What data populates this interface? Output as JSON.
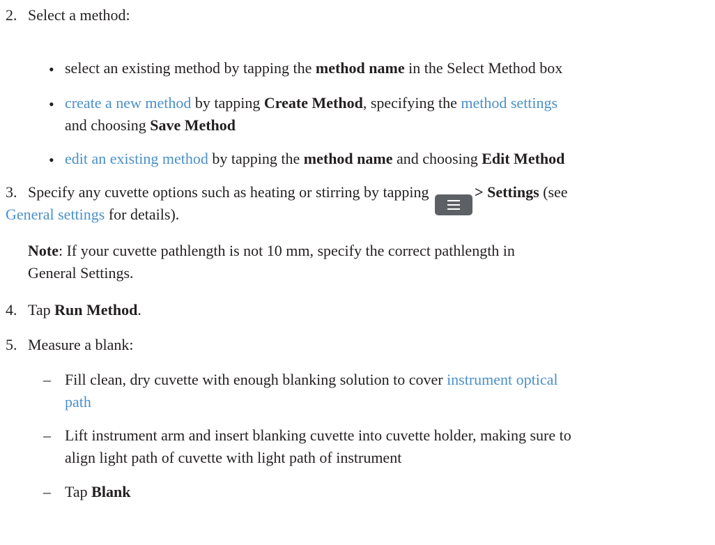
{
  "step2": {
    "num": "2.",
    "text": "Select a method:",
    "b1": {
      "pre": "select an existing method by tapping the ",
      "bold1": "method name",
      "post": " in the Select Method box"
    },
    "b2": {
      "link1": "create a new method",
      "mid1": " by tapping ",
      "bold1": "Create Method",
      "mid2": ", specifying the ",
      "link2": "method settings",
      "line2_pre": "and choosing ",
      "bold2": "Save Method"
    },
    "b3": {
      "link1": "edit an existing method",
      "mid1": " by tapping the ",
      "bold1": "method name",
      "mid2": " and choosing ",
      "bold2": "Edit Method"
    }
  },
  "step3": {
    "num": "3.",
    "pre": "Specify any cuvette options such as heating or stirring by tapping ",
    "menu_icon": "menu-icon",
    "bold1": "> Settings",
    "post": " (see",
    "link1": "General settings",
    "post2": " for details).",
    "note_label": "Note",
    "note_text1": ": If your cuvette pathlength is not 10 mm, specify the correct pathlength in",
    "note_text2": "General Settings."
  },
  "step4": {
    "num": "4.",
    "pre": "Tap ",
    "bold1": "Run Method",
    "post": "."
  },
  "step5": {
    "num": "5.",
    "text": "Measure a blank:",
    "d1": {
      "dash": "–",
      "pre": "Fill clean, dry cuvette with enough blanking solution to cover ",
      "link1": "instrument optical",
      "link1b": "path"
    },
    "d2": {
      "dash": "–",
      "line1": "Lift instrument arm and insert blanking cuvette into cuvette holder, making sure to",
      "line2": "align light path of cuvette with light path of instrument"
    },
    "d3": {
      "dash": "–",
      "pre": "Tap ",
      "bold1": "Blank"
    }
  },
  "colors": {
    "link": "#4a90c8",
    "text": "#231f20",
    "button": "#5d6166"
  }
}
